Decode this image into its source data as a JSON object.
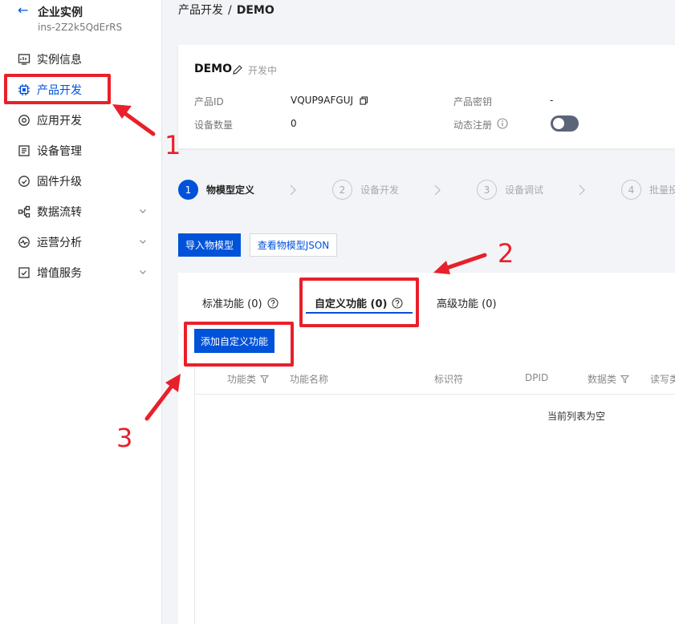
{
  "sidebar": {
    "back_icon": "arrow-left-icon",
    "title": "企业实例",
    "subtitle": "ins-2Z2k5QdErRS",
    "items": [
      {
        "label": "实例信息",
        "icon": "monitor-icon"
      },
      {
        "label": "产品开发",
        "icon": "chip-icon",
        "active": true
      },
      {
        "label": "应用开发",
        "icon": "app-gear-icon"
      },
      {
        "label": "设备管理",
        "icon": "device-list-icon"
      },
      {
        "label": "固件升级",
        "icon": "firmware-icon"
      },
      {
        "label": "数据流转",
        "icon": "flow-icon",
        "expandable": true
      },
      {
        "label": "运营分析",
        "icon": "pulse-icon",
        "expandable": true
      },
      {
        "label": "增值服务",
        "icon": "service-icon",
        "expandable": true
      }
    ]
  },
  "breadcrumb": {
    "parent": "产品开发",
    "separator": "/",
    "current": "DEMO"
  },
  "product": {
    "name": "DEMO",
    "status": "开发中",
    "id_label": "产品ID",
    "id_value": "VQUP9AFGUJ",
    "secret_label": "产品密钥",
    "secret_value": "-",
    "device_count_label": "设备数量",
    "device_count_value": "0",
    "dynamic_reg_label": "动态注册",
    "dynamic_reg_enabled": false
  },
  "steps": [
    {
      "num": "1",
      "label": "物模型定义",
      "active": true
    },
    {
      "num": "2",
      "label": "设备开发"
    },
    {
      "num": "3",
      "label": "设备调试"
    },
    {
      "num": "4",
      "label": "批量投"
    }
  ],
  "buttons": {
    "import_model": "导入物模型",
    "view_json": "查看物模型JSON",
    "add_custom": "添加自定义功能"
  },
  "tabs": [
    {
      "label": "标准功能 (0)",
      "help": true
    },
    {
      "label": "自定义功能 (0)",
      "help": true,
      "active": true
    },
    {
      "label": "高级功能 (0)",
      "help": false
    }
  ],
  "table": {
    "columns": [
      {
        "label": "功能类",
        "filter": true
      },
      {
        "label": "功能名称"
      },
      {
        "label": "标识符"
      },
      {
        "label": "DPID"
      },
      {
        "label": "数据类",
        "filter": true
      },
      {
        "label": "读写类"
      }
    ],
    "empty_text": "当前列表为空"
  },
  "annotations": {
    "color": "#e8202a",
    "labels": [
      "1",
      "2",
      "3"
    ]
  },
  "colors": {
    "primary": "#0052d9",
    "annotation": "#e8202a",
    "toggle_off": "#5b6478"
  }
}
